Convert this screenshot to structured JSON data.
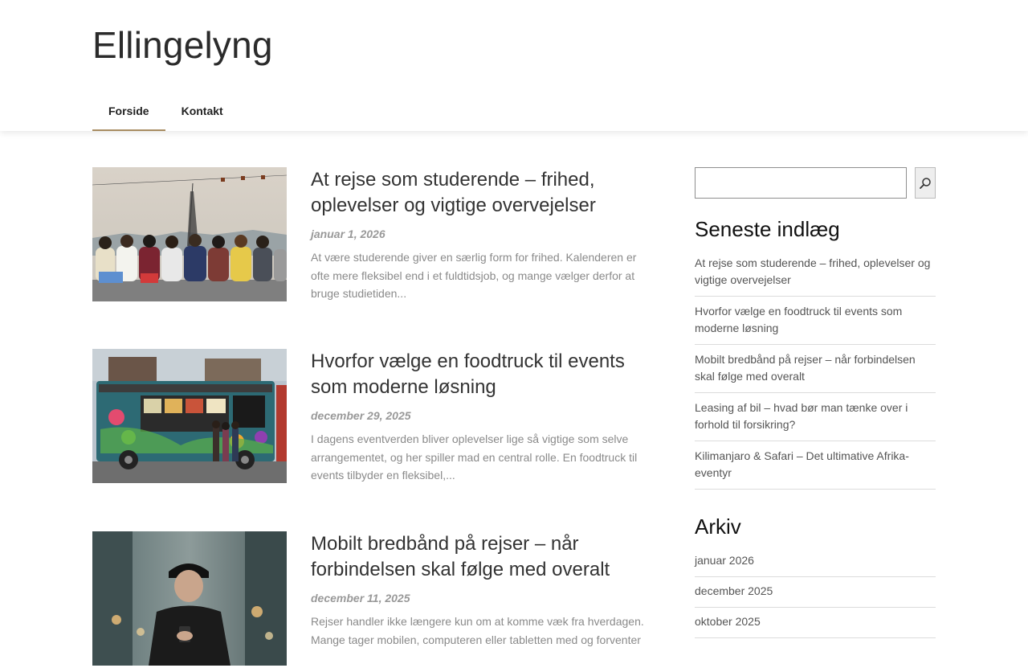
{
  "site": {
    "title": "Ellingelyng"
  },
  "nav": {
    "items": [
      {
        "label": "Forside",
        "active": true
      },
      {
        "label": "Kontakt",
        "active": false
      }
    ]
  },
  "posts": [
    {
      "title": "At rejse som studerende – frihed, oplevelser og vigtige overvejelser",
      "date": "januar 1, 2026",
      "excerpt": "At være studerende giver en særlig form for frihed. Kalenderen er ofte mere fleksibel end i et fuldtidsjob, og mange vælger derfor at bruge studietiden...",
      "image": "students-sitting-by-sea"
    },
    {
      "title": "Hvorfor vælge en foodtruck til events som moderne løsning",
      "date": "december 29, 2025",
      "excerpt": "I dagens eventverden bliver oplevelser lige så vigtige som selve arrangementet, og her spiller mad en central rolle. En foodtruck til events tilbyder en fleksibel,...",
      "image": "colorful-food-truck"
    },
    {
      "title": "Mobilt bredbånd på rejser – når forbindelsen skal følge med overalt",
      "date": "december 11, 2025",
      "excerpt": "Rejser handler ikke længere kun om at komme væk fra hverdagen. Mange tager mobilen, computeren eller tabletten med og forventer",
      "image": "man-with-cap-using-phone"
    }
  ],
  "sidebar": {
    "search": {
      "placeholder": "",
      "button_icon": "search-icon"
    },
    "recent": {
      "title": "Seneste indlæg",
      "items": [
        "At rejse som studerende – frihed, oplevelser og vigtige overvejelser",
        "Hvorfor vælge en foodtruck til events som moderne løsning",
        "Mobilt bredbånd på rejser – når forbindelsen skal følge med overalt",
        "Leasing af bil – hvad bør man tænke over i forhold til forsikring?",
        "Kilimanjaro & Safari – Det ultimative Afrika-eventyr"
      ]
    },
    "archive": {
      "title": "Arkiv",
      "items": [
        "januar 2026",
        "december 2025",
        "oktober 2025"
      ]
    }
  },
  "colors": {
    "nav_underline": "#a88d62",
    "text": "#333333",
    "muted": "#8a8a8a"
  }
}
